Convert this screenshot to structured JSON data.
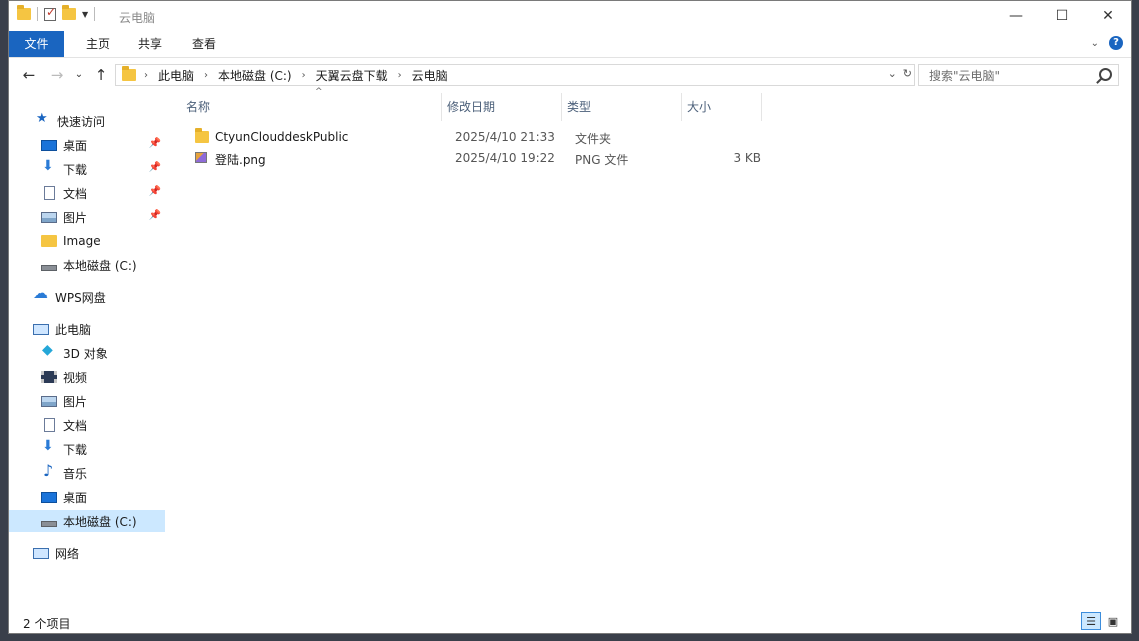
{
  "window": {
    "title": "云电脑"
  },
  "window_controls": {
    "minimize": "—",
    "maximize": "☐",
    "close": "✕"
  },
  "ribbon": {
    "tabs": [
      "文件",
      "主页",
      "共享",
      "查看"
    ]
  },
  "nav": {
    "back": "←",
    "forward": "→",
    "dropdown": "⌄",
    "up": "↑"
  },
  "address": {
    "crumbs": [
      "此电脑",
      "本地磁盘 (C:)",
      "天翼云盘下载",
      "云电脑"
    ],
    "separator": "›",
    "dropdown": "⌄",
    "refresh": "↻"
  },
  "search": {
    "placeholder": "搜索\"云电脑\""
  },
  "sidebar": {
    "pin_glyph": "📌",
    "items": [
      {
        "label": "快速访问",
        "icon": "star-icon"
      },
      {
        "label": "桌面",
        "icon": "desktop-icon",
        "pinned": true
      },
      {
        "label": "下载",
        "icon": "download-icon",
        "pinned": true
      },
      {
        "label": "文档",
        "icon": "document-icon",
        "pinned": true
      },
      {
        "label": "图片",
        "icon": "picture-icon",
        "pinned": true
      },
      {
        "label": "Image",
        "icon": "folder-icon"
      },
      {
        "label": "本地磁盘 (C:)",
        "icon": "drive-icon"
      },
      {
        "label": "WPS网盘",
        "icon": "cloud-icon"
      },
      {
        "label": "此电脑",
        "icon": "computer-icon"
      },
      {
        "label": "3D 对象",
        "icon": "cube-icon"
      },
      {
        "label": "视频",
        "icon": "video-icon"
      },
      {
        "label": "图片",
        "icon": "picture-icon"
      },
      {
        "label": "文档",
        "icon": "document-icon"
      },
      {
        "label": "下载",
        "icon": "download-icon"
      },
      {
        "label": "音乐",
        "icon": "music-icon"
      },
      {
        "label": "桌面",
        "icon": "desktop-icon"
      },
      {
        "label": "本地磁盘 (C:)",
        "icon": "drive-icon",
        "selected": true
      },
      {
        "label": "网络",
        "icon": "network-icon"
      }
    ]
  },
  "columns": [
    "名称",
    "修改日期",
    "类型",
    "大小"
  ],
  "sort_indicator": "^",
  "files": [
    {
      "name": "CtyunClouddeskPublic",
      "date": "2025/4/10 21:33",
      "type": "文件夹",
      "size": "",
      "icon": "folder-icon"
    },
    {
      "name": "登陆.png",
      "date": "2025/4/10 19:22",
      "type": "PNG 文件",
      "size": "3 KB",
      "icon": "png-file-icon"
    }
  ],
  "status": {
    "item_count": "2 个项目"
  },
  "view_buttons": {
    "details": "☰",
    "large_icons": "▣"
  },
  "colors": {
    "accent": "#1a65c0",
    "selected_bg": "#cce8ff"
  }
}
